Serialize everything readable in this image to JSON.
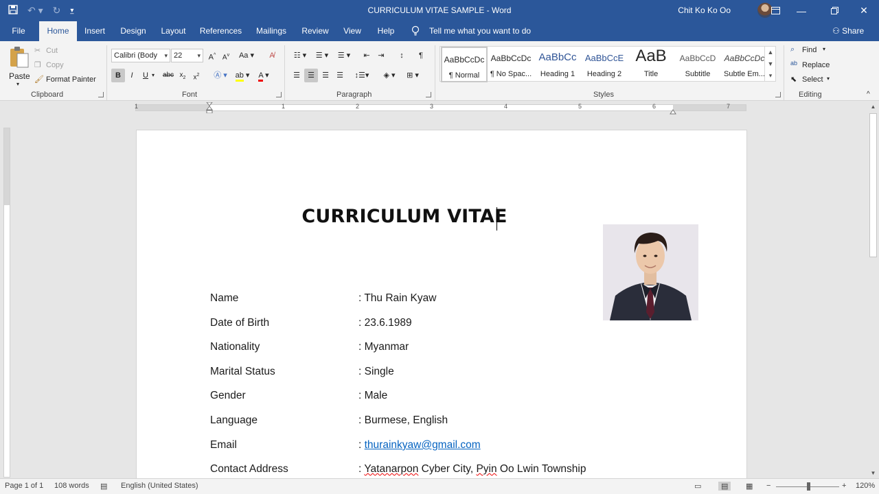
{
  "window": {
    "title": "CURRICULUM VITAE SAMPLE  -  Word",
    "user_name": "Chit Ko Ko Oo"
  },
  "tabs": [
    {
      "label": "File"
    },
    {
      "label": "Home"
    },
    {
      "label": "Insert"
    },
    {
      "label": "Design"
    },
    {
      "label": "Layout"
    },
    {
      "label": "References"
    },
    {
      "label": "Mailings"
    },
    {
      "label": "Review"
    },
    {
      "label": "View"
    },
    {
      "label": "Help"
    }
  ],
  "tell_me": "Tell me what you want to do",
  "share": "Share",
  "ribbon": {
    "clipboard": {
      "label": "Clipboard",
      "paste": "Paste",
      "cut": "Cut",
      "copy": "Copy",
      "format_painter": "Format Painter"
    },
    "font": {
      "label": "Font",
      "font_name": "Calibri (Body",
      "font_size": "22"
    },
    "paragraph": {
      "label": "Paragraph"
    },
    "styles": {
      "label": "Styles",
      "items": [
        {
          "preview": "AaBbCcDc",
          "name": "¶ Normal"
        },
        {
          "preview": "AaBbCcDc",
          "name": "¶ No Spac..."
        },
        {
          "preview": "AaBbCc",
          "name": "Heading 1"
        },
        {
          "preview": "AaBbCcE",
          "name": "Heading 2"
        },
        {
          "preview": "AaB",
          "name": "Title"
        },
        {
          "preview": "AaBbCcD",
          "name": "Subtitle"
        },
        {
          "preview": "AaBbCcDc",
          "name": "Subtle Em..."
        }
      ]
    },
    "editing": {
      "label": "Editing",
      "find": "Find",
      "replace": "Replace",
      "select": "Select"
    }
  },
  "ruler_numbers": [
    "1",
    "1",
    "2",
    "3",
    "4",
    "5",
    "6",
    "7"
  ],
  "document": {
    "title": "CURRICULUM VITAE",
    "rows": [
      {
        "label": "Name",
        "value": ": Thu Rain Kyaw"
      },
      {
        "label": "Date of Birth",
        "value": ": 23.6.1989"
      },
      {
        "label": "Nationality",
        "value": ": Myanmar"
      },
      {
        "label": "Marital Status",
        "value": ": Single"
      },
      {
        "label": "Gender",
        "value": ": Male"
      },
      {
        "label": "Language",
        "value": ": Burmese, English"
      },
      {
        "label": "Email",
        "value_prefix": ": ",
        "value_link": "thurainkyaw@gmail.com"
      },
      {
        "label": "Contact Address",
        "value_prefix": ": ",
        "value_parts": [
          "Yatanarpon",
          " Cyber City, ",
          "Pyin",
          " Oo Lwin Township"
        ]
      }
    ]
  },
  "status": {
    "page": "Page 1 of 1",
    "words": "108 words",
    "language": "English (United States)",
    "zoom": "120%"
  },
  "colors": {
    "titlebar": "#2b579a",
    "ribbon": "#f3f3f3",
    "link": "#0563c1"
  }
}
